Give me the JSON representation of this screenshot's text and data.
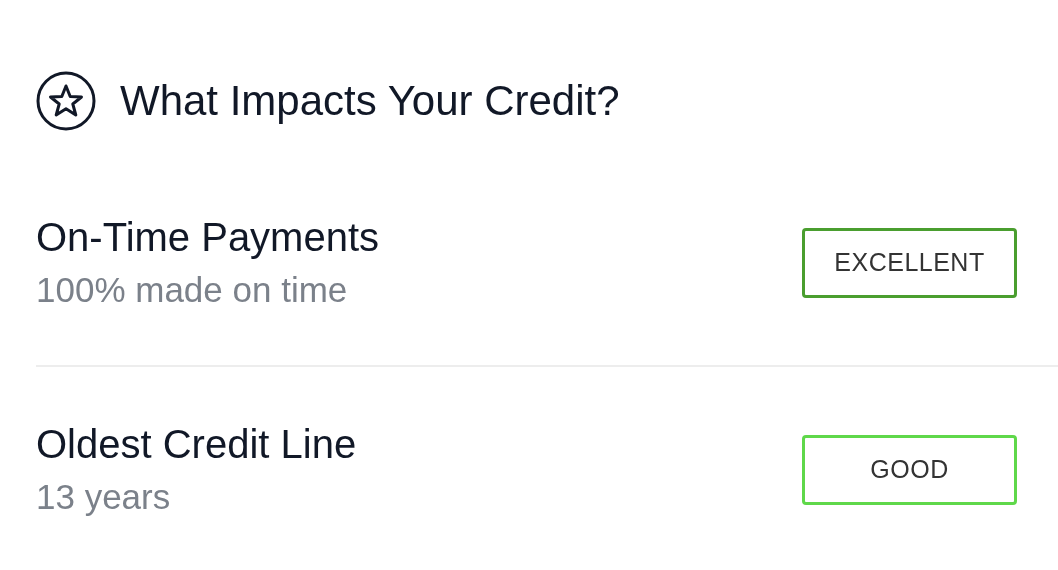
{
  "header": {
    "title": "What Impacts Your Credit?"
  },
  "factors": [
    {
      "name": "On-Time Payments",
      "detail": "100% made on time",
      "rating": "EXCELLENT",
      "color": "#4a9e2f"
    },
    {
      "name": "Oldest Credit Line",
      "detail": "13 years",
      "rating": "GOOD",
      "color": "#5fd84a"
    }
  ]
}
